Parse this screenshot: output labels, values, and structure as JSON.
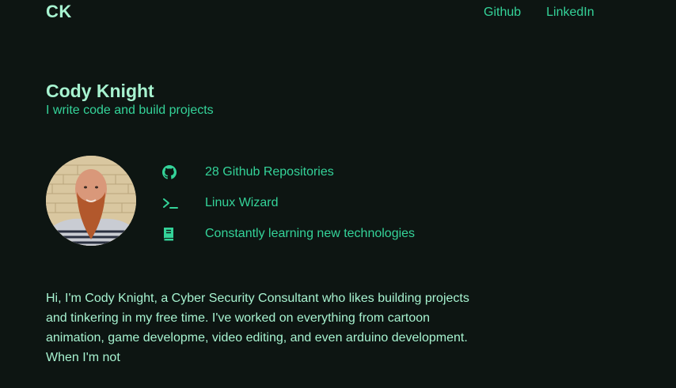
{
  "header": {
    "logo": "CK",
    "nav": [
      {
        "label": "Github"
      },
      {
        "label": "LinkedIn"
      }
    ]
  },
  "hero": {
    "name": "Cody Knight",
    "tagline": "I write code and build projects"
  },
  "facts": [
    {
      "icon": "github-icon",
      "label": "28 Github Repositories"
    },
    {
      "icon": "terminal-icon",
      "label": "Linux Wizard"
    },
    {
      "icon": "book-icon",
      "label": "Constantly learning new technologies"
    }
  ],
  "bio": "Hi, I'm Cody Knight, a Cyber Security Consultant who likes building projects and tinkering in my free time. I've worked on everything from cartoon animation, game developme, video editing, and even arduino development. When I'm not",
  "colors": {
    "background": "#0d1512",
    "heading": "#a7f3d0",
    "accent": "#34d399"
  }
}
